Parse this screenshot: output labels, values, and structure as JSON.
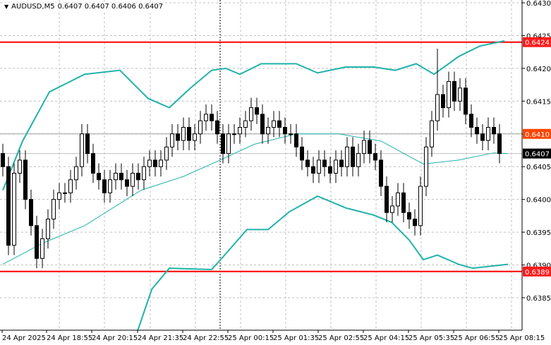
{
  "header": {
    "symbol": "AUDUSD,M5",
    "ohlc": "0.6407 0.6407 0.6406 0.6407",
    "menu_icon": "triangle-down-icon"
  },
  "colors": {
    "background": "#ffffff",
    "grid": "#c0c0c0",
    "band": "#20b2aa",
    "level_line": "#ff0000",
    "level_label": "#ff1a1a",
    "mid_label": "#ff4500",
    "price_label": "#000000"
  },
  "price_axis": {
    "ticks": [
      "0.6430",
      "0.6425",
      "0.6420",
      "0.6415",
      "0.6410",
      "0.6405",
      "0.6400",
      "0.6395",
      "0.6390",
      "0.6385"
    ],
    "tick_values": [
      0.643,
      0.6425,
      0.642,
      0.6415,
      0.641,
      0.6405,
      0.64,
      0.6395,
      0.639,
      0.6385
    ]
  },
  "time_axis": {
    "labels": [
      "24 Apr 2025",
      "24 Apr 18:55",
      "24 Apr 20:15",
      "24 Apr 21:35",
      "24 Apr 22:55",
      "25 Apr 00:15",
      "25 Apr 01:35",
      "25 Apr 02:55",
      "25 Apr 04:15",
      "25 Apr 05:35",
      "25 Apr 06:55",
      "25 Apr 08:15"
    ]
  },
  "levels": [
    {
      "label": "0.6424",
      "value": 0.6424,
      "kind": "resistance"
    },
    {
      "label": "0.6410",
      "value": 0.641,
      "kind": "mid"
    },
    {
      "label": "0.6407",
      "value": 0.6407,
      "kind": "current"
    },
    {
      "label": "0.6389",
      "value": 0.6389,
      "kind": "support"
    }
  ],
  "chart_data": {
    "type": "candlestick",
    "ylim": [
      0.638,
      0.6431
    ],
    "closes": [
      0.6405,
      0.6393,
      0.6404,
      0.6406,
      0.64,
      0.6396,
      0.6391,
      0.6394,
      0.6397,
      0.64,
      0.6401,
      0.6401,
      0.6403,
      0.6405,
      0.641,
      0.6407,
      0.6404,
      0.6403,
      0.6401,
      0.6403,
      0.6404,
      0.6403,
      0.6402,
      0.6404,
      0.6403,
      0.6405,
      0.6406,
      0.6405,
      0.6406,
      0.6408,
      0.641,
      0.6409,
      0.6411,
      0.6409,
      0.641,
      0.6412,
      0.6413,
      0.6412,
      0.641,
      0.6407,
      0.641,
      0.641,
      0.6411,
      0.6412,
      0.6414,
      0.6413,
      0.641,
      0.6411,
      0.6412,
      0.6411,
      0.641,
      0.641,
      0.6408,
      0.6406,
      0.6405,
      0.6404,
      0.6406,
      0.6405,
      0.6404,
      0.6406,
      0.6405,
      0.6408,
      0.6405,
      0.6407,
      0.6409,
      0.6407,
      0.6406,
      0.6402,
      0.6398,
      0.6399,
      0.6401,
      0.6398,
      0.6397,
      0.6396,
      0.6402,
      0.6408,
      0.6412,
      0.6416,
      0.6414,
      0.6418,
      0.6415,
      0.6417,
      0.6413,
      0.6411,
      0.641,
      0.6409,
      0.6411,
      0.641,
      0.6407
    ],
    "upper_band": [
      [
        0,
        0.64014
      ],
      [
        3.5,
        0.64089
      ],
      [
        8.25,
        0.64164
      ],
      [
        14.5,
        0.64191
      ],
      [
        20.75,
        0.64197
      ],
      [
        25.75,
        0.64154
      ],
      [
        29.5,
        0.6414
      ],
      [
        33.25,
        0.6417
      ],
      [
        37,
        0.64197
      ],
      [
        39.5,
        0.642
      ],
      [
        42,
        0.64191
      ],
      [
        45.75,
        0.64207
      ],
      [
        52,
        0.64207
      ],
      [
        55.75,
        0.64193
      ],
      [
        60.75,
        0.64202
      ],
      [
        65.75,
        0.64202
      ],
      [
        69.5,
        0.64197
      ],
      [
        73.25,
        0.64207
      ],
      [
        76.4,
        0.64191
      ],
      [
        80.75,
        0.64218
      ],
      [
        84.5,
        0.64234
      ],
      [
        88.9,
        0.64242
      ]
    ],
    "middle_band": [
      [
        0,
        0.63901
      ],
      [
        7,
        0.63933
      ],
      [
        14.5,
        0.6396
      ],
      [
        24.5,
        0.64014
      ],
      [
        32,
        0.64035
      ],
      [
        38.25,
        0.64059
      ],
      [
        44.5,
        0.64084
      ],
      [
        52,
        0.641
      ],
      [
        59.5,
        0.641
      ],
      [
        67,
        0.64089
      ],
      [
        74.5,
        0.64054
      ],
      [
        80.75,
        0.6406
      ],
      [
        87,
        0.64071
      ],
      [
        89.5,
        0.6407
      ]
    ],
    "lower_band": [
      [
        23.9,
        0.638
      ],
      [
        26.4,
        0.63863
      ],
      [
        29.5,
        0.63895
      ],
      [
        37,
        0.63893
      ],
      [
        39.5,
        0.63917
      ],
      [
        43.25,
        0.63954
      ],
      [
        47,
        0.63954
      ],
      [
        50.75,
        0.63981
      ],
      [
        55.75,
        0.64005
      ],
      [
        60.75,
        0.63987
      ],
      [
        65.75,
        0.63976
      ],
      [
        68.9,
        0.63965
      ],
      [
        72,
        0.63938
      ],
      [
        74.5,
        0.63908
      ],
      [
        77,
        0.63915
      ],
      [
        80.75,
        0.63901
      ],
      [
        83.25,
        0.63895
      ],
      [
        89.5,
        0.63901
      ]
    ]
  }
}
